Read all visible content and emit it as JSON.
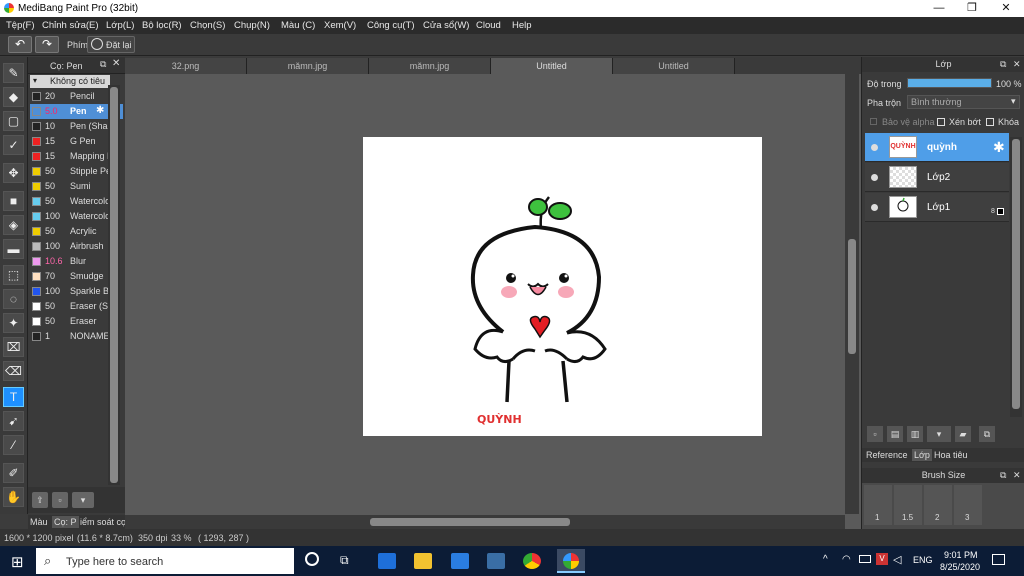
{
  "window": {
    "title": "MediBang Paint Pro (32bit)",
    "min": "—",
    "max": "❐",
    "close": "✕"
  },
  "menu": [
    "Tệp(F)",
    "Chỉnh sửa(E)",
    "Lớp(L)",
    "Bộ lọc(R)",
    "Chọn(S)",
    "Chụp(N)",
    "Màu (C)",
    "Xem(V)",
    "Công cụ(T)",
    "Cửa sổ(W)",
    "Cloud",
    "Help"
  ],
  "toolbar": {
    "undo": "↶",
    "redo": "↷",
    "key_label": "Phím",
    "reset_label": "Đặt lại"
  },
  "brush_panel": {
    "title": "Cọ: Pen",
    "category": "Không có tiêu",
    "brushes": [
      {
        "size": "20",
        "name": "Pencil",
        "color": "#222222"
      },
      {
        "size": "5.0",
        "name": "Pen",
        "color": "#4f8fd6"
      },
      {
        "size": "10",
        "name": "Pen (Sha",
        "color": "#222222"
      },
      {
        "size": "15",
        "name": "G Pen",
        "color": "#ee2222"
      },
      {
        "size": "15",
        "name": "Mapping P",
        "color": "#ee2222"
      },
      {
        "size": "50",
        "name": "Stipple Pe",
        "color": "#eecc00"
      },
      {
        "size": "50",
        "name": "Sumi",
        "color": "#eecc00"
      },
      {
        "size": "50",
        "name": "Watercolo",
        "color": "#66ccee"
      },
      {
        "size": "100",
        "name": "Watercolo",
        "color": "#66ccee"
      },
      {
        "size": "50",
        "name": "Acrylic",
        "color": "#eecc00"
      },
      {
        "size": "100",
        "name": "Airbrush",
        "color": "#bbbbbb"
      },
      {
        "size": "10.6",
        "name": "Blur",
        "color": "#ee99ee"
      },
      {
        "size": "70",
        "name": "Smudge",
        "color": "#ffe0c0"
      },
      {
        "size": "100",
        "name": "Sparkle B",
        "color": "#2255ee"
      },
      {
        "size": "50",
        "name": "Eraser (Sc",
        "color": "#ffffff"
      },
      {
        "size": "50",
        "name": "Eraser",
        "color": "#ffffff"
      },
      {
        "size": "1",
        "name": "NONAME",
        "color": "#222222"
      }
    ],
    "bottom_tabs": [
      "Màu",
      "Cọ: P",
      "iểm soát cọ"
    ]
  },
  "doc_tabs": [
    "32.png",
    "mămn.jpg",
    "mămn.jpg",
    "Untitled",
    "Untitled"
  ],
  "canvas": {
    "signature": "QUỲNH"
  },
  "layer_panel": {
    "title": "Lớp",
    "opacity_label": "Độ trong",
    "opacity_value": "100 %",
    "opacity_fraction": 1.0,
    "blend_label": "Pha trộn",
    "blend_value": "Bình thường",
    "protect_alpha": "Bảo vệ alpha",
    "clipping": "Xén bớt",
    "lock": "Khóa",
    "layers": [
      {
        "name": "quỳnh",
        "thumb": "QUỲNH"
      },
      {
        "name": "Lớp2",
        "thumb": ""
      },
      {
        "name": "Lớp1",
        "thumb": "",
        "badge": "8"
      }
    ],
    "bottom_tabs": [
      "Reference",
      "Lớp",
      "Hoa tiêu"
    ]
  },
  "brush_size_panel": {
    "title": "Brush Size",
    "sizes": [
      "1",
      "1.5",
      "2",
      "3"
    ]
  },
  "status": {
    "dims": "1600 * 1200 pixel",
    "physical": "(11.6 * 8.7cm)",
    "dpi": "350 dpi",
    "zoom": "33 %",
    "coords": "( 1293, 287 )"
  },
  "taskbar": {
    "search_placeholder": "Type here to search",
    "time": "9:01 PM",
    "date": "8/25/2020",
    "lang": "ENG",
    "chevron": "^"
  }
}
